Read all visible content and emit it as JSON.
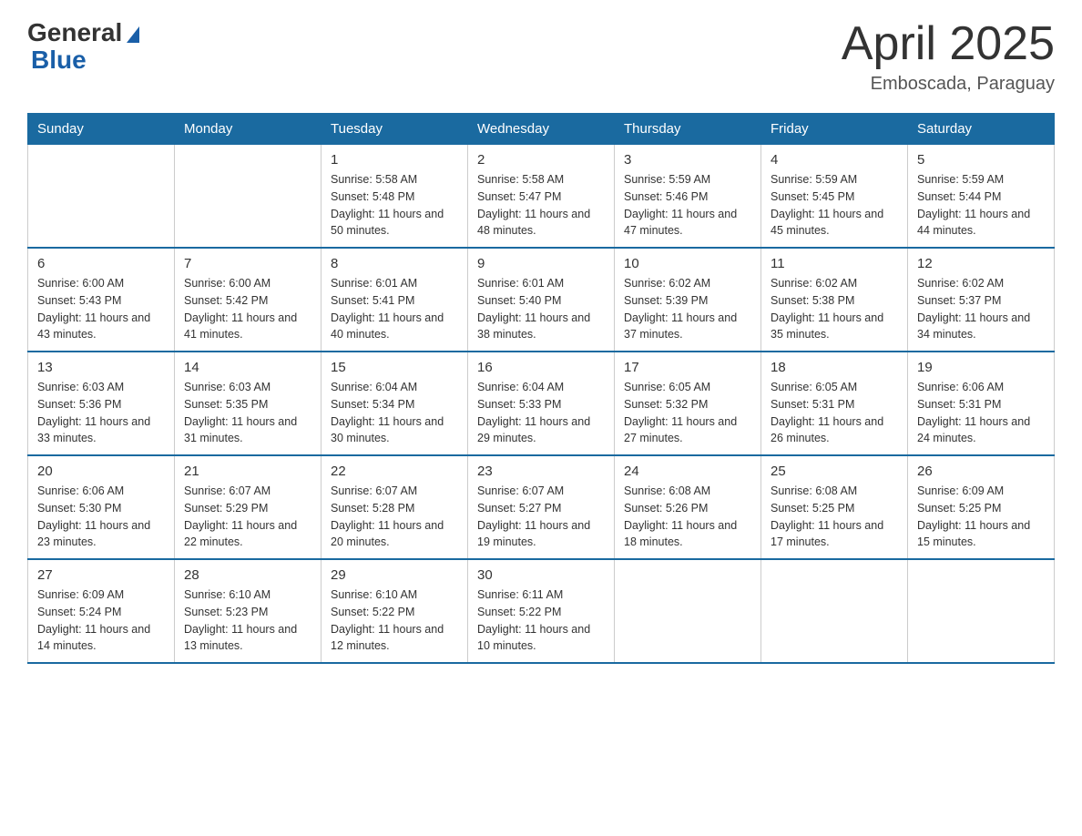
{
  "header": {
    "logo_general": "General",
    "logo_blue": "Blue",
    "month_title": "April 2025",
    "location": "Emboscada, Paraguay"
  },
  "weekdays": [
    "Sunday",
    "Monday",
    "Tuesday",
    "Wednesday",
    "Thursday",
    "Friday",
    "Saturday"
  ],
  "weeks": [
    [
      {
        "day": "",
        "sunrise": "",
        "sunset": "",
        "daylight": ""
      },
      {
        "day": "",
        "sunrise": "",
        "sunset": "",
        "daylight": ""
      },
      {
        "day": "1",
        "sunrise": "Sunrise: 5:58 AM",
        "sunset": "Sunset: 5:48 PM",
        "daylight": "Daylight: 11 hours and 50 minutes."
      },
      {
        "day": "2",
        "sunrise": "Sunrise: 5:58 AM",
        "sunset": "Sunset: 5:47 PM",
        "daylight": "Daylight: 11 hours and 48 minutes."
      },
      {
        "day": "3",
        "sunrise": "Sunrise: 5:59 AM",
        "sunset": "Sunset: 5:46 PM",
        "daylight": "Daylight: 11 hours and 47 minutes."
      },
      {
        "day": "4",
        "sunrise": "Sunrise: 5:59 AM",
        "sunset": "Sunset: 5:45 PM",
        "daylight": "Daylight: 11 hours and 45 minutes."
      },
      {
        "day": "5",
        "sunrise": "Sunrise: 5:59 AM",
        "sunset": "Sunset: 5:44 PM",
        "daylight": "Daylight: 11 hours and 44 minutes."
      }
    ],
    [
      {
        "day": "6",
        "sunrise": "Sunrise: 6:00 AM",
        "sunset": "Sunset: 5:43 PM",
        "daylight": "Daylight: 11 hours and 43 minutes."
      },
      {
        "day": "7",
        "sunrise": "Sunrise: 6:00 AM",
        "sunset": "Sunset: 5:42 PM",
        "daylight": "Daylight: 11 hours and 41 minutes."
      },
      {
        "day": "8",
        "sunrise": "Sunrise: 6:01 AM",
        "sunset": "Sunset: 5:41 PM",
        "daylight": "Daylight: 11 hours and 40 minutes."
      },
      {
        "day": "9",
        "sunrise": "Sunrise: 6:01 AM",
        "sunset": "Sunset: 5:40 PM",
        "daylight": "Daylight: 11 hours and 38 minutes."
      },
      {
        "day": "10",
        "sunrise": "Sunrise: 6:02 AM",
        "sunset": "Sunset: 5:39 PM",
        "daylight": "Daylight: 11 hours and 37 minutes."
      },
      {
        "day": "11",
        "sunrise": "Sunrise: 6:02 AM",
        "sunset": "Sunset: 5:38 PM",
        "daylight": "Daylight: 11 hours and 35 minutes."
      },
      {
        "day": "12",
        "sunrise": "Sunrise: 6:02 AM",
        "sunset": "Sunset: 5:37 PM",
        "daylight": "Daylight: 11 hours and 34 minutes."
      }
    ],
    [
      {
        "day": "13",
        "sunrise": "Sunrise: 6:03 AM",
        "sunset": "Sunset: 5:36 PM",
        "daylight": "Daylight: 11 hours and 33 minutes."
      },
      {
        "day": "14",
        "sunrise": "Sunrise: 6:03 AM",
        "sunset": "Sunset: 5:35 PM",
        "daylight": "Daylight: 11 hours and 31 minutes."
      },
      {
        "day": "15",
        "sunrise": "Sunrise: 6:04 AM",
        "sunset": "Sunset: 5:34 PM",
        "daylight": "Daylight: 11 hours and 30 minutes."
      },
      {
        "day": "16",
        "sunrise": "Sunrise: 6:04 AM",
        "sunset": "Sunset: 5:33 PM",
        "daylight": "Daylight: 11 hours and 29 minutes."
      },
      {
        "day": "17",
        "sunrise": "Sunrise: 6:05 AM",
        "sunset": "Sunset: 5:32 PM",
        "daylight": "Daylight: 11 hours and 27 minutes."
      },
      {
        "day": "18",
        "sunrise": "Sunrise: 6:05 AM",
        "sunset": "Sunset: 5:31 PM",
        "daylight": "Daylight: 11 hours and 26 minutes."
      },
      {
        "day": "19",
        "sunrise": "Sunrise: 6:06 AM",
        "sunset": "Sunset: 5:31 PM",
        "daylight": "Daylight: 11 hours and 24 minutes."
      }
    ],
    [
      {
        "day": "20",
        "sunrise": "Sunrise: 6:06 AM",
        "sunset": "Sunset: 5:30 PM",
        "daylight": "Daylight: 11 hours and 23 minutes."
      },
      {
        "day": "21",
        "sunrise": "Sunrise: 6:07 AM",
        "sunset": "Sunset: 5:29 PM",
        "daylight": "Daylight: 11 hours and 22 minutes."
      },
      {
        "day": "22",
        "sunrise": "Sunrise: 6:07 AM",
        "sunset": "Sunset: 5:28 PM",
        "daylight": "Daylight: 11 hours and 20 minutes."
      },
      {
        "day": "23",
        "sunrise": "Sunrise: 6:07 AM",
        "sunset": "Sunset: 5:27 PM",
        "daylight": "Daylight: 11 hours and 19 minutes."
      },
      {
        "day": "24",
        "sunrise": "Sunrise: 6:08 AM",
        "sunset": "Sunset: 5:26 PM",
        "daylight": "Daylight: 11 hours and 18 minutes."
      },
      {
        "day": "25",
        "sunrise": "Sunrise: 6:08 AM",
        "sunset": "Sunset: 5:25 PM",
        "daylight": "Daylight: 11 hours and 17 minutes."
      },
      {
        "day": "26",
        "sunrise": "Sunrise: 6:09 AM",
        "sunset": "Sunset: 5:25 PM",
        "daylight": "Daylight: 11 hours and 15 minutes."
      }
    ],
    [
      {
        "day": "27",
        "sunrise": "Sunrise: 6:09 AM",
        "sunset": "Sunset: 5:24 PM",
        "daylight": "Daylight: 11 hours and 14 minutes."
      },
      {
        "day": "28",
        "sunrise": "Sunrise: 6:10 AM",
        "sunset": "Sunset: 5:23 PM",
        "daylight": "Daylight: 11 hours and 13 minutes."
      },
      {
        "day": "29",
        "sunrise": "Sunrise: 6:10 AM",
        "sunset": "Sunset: 5:22 PM",
        "daylight": "Daylight: 11 hours and 12 minutes."
      },
      {
        "day": "30",
        "sunrise": "Sunrise: 6:11 AM",
        "sunset": "Sunset: 5:22 PM",
        "daylight": "Daylight: 11 hours and 10 minutes."
      },
      {
        "day": "",
        "sunrise": "",
        "sunset": "",
        "daylight": ""
      },
      {
        "day": "",
        "sunrise": "",
        "sunset": "",
        "daylight": ""
      },
      {
        "day": "",
        "sunrise": "",
        "sunset": "",
        "daylight": ""
      }
    ]
  ]
}
